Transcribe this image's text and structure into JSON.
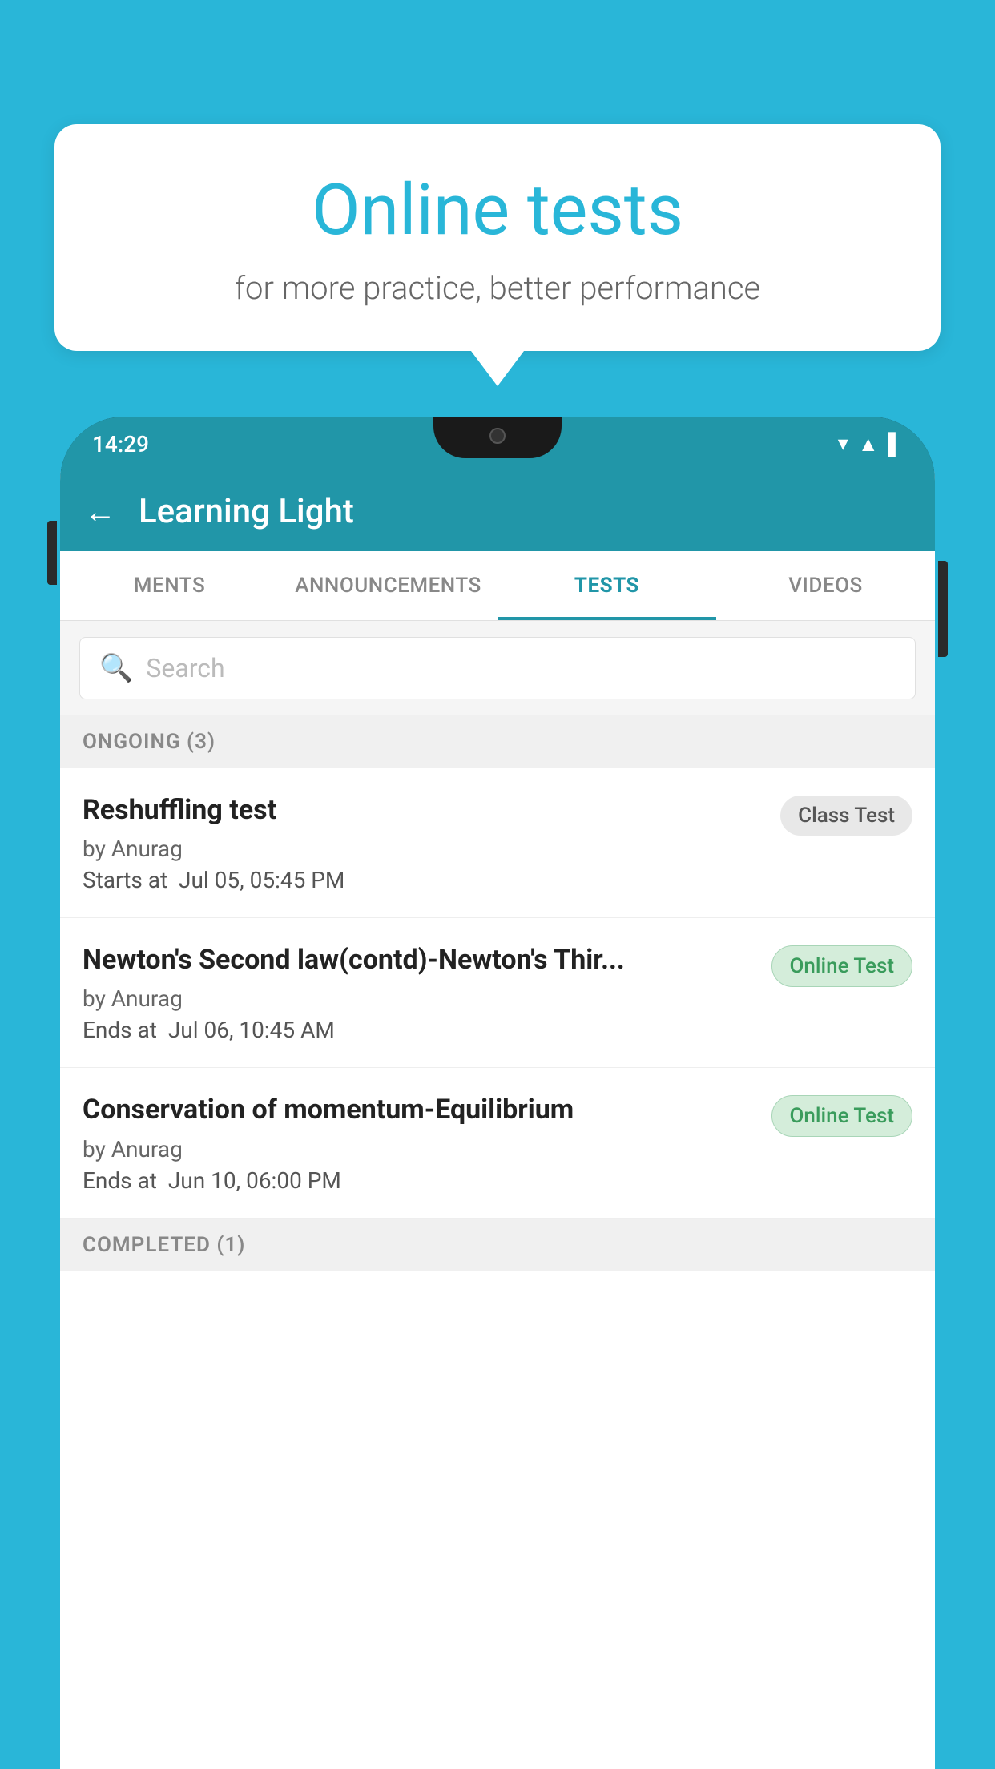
{
  "background_color": "#29b6d8",
  "bubble": {
    "title": "Online tests",
    "subtitle": "for more practice, better performance"
  },
  "phone": {
    "status_bar": {
      "time": "14:29",
      "icons": [
        "wifi",
        "signal",
        "battery"
      ]
    },
    "app_header": {
      "title": "Learning Light",
      "back_label": "←"
    },
    "tabs": [
      {
        "label": "MENTS",
        "active": false
      },
      {
        "label": "ANNOUNCEMENTS",
        "active": false
      },
      {
        "label": "TESTS",
        "active": true
      },
      {
        "label": "VIDEOS",
        "active": false
      }
    ],
    "search": {
      "placeholder": "Search"
    },
    "ongoing_section": {
      "header": "ONGOING (3)",
      "tests": [
        {
          "name": "Reshuffling test",
          "by": "by Anurag",
          "date_label": "Starts at",
          "date": "Jul 05, 05:45 PM",
          "badge": "Class Test",
          "badge_type": "class"
        },
        {
          "name": "Newton's Second law(contd)-Newton's Thir...",
          "by": "by Anurag",
          "date_label": "Ends at",
          "date": "Jul 06, 10:45 AM",
          "badge": "Online Test",
          "badge_type": "online"
        },
        {
          "name": "Conservation of momentum-Equilibrium",
          "by": "by Anurag",
          "date_label": "Ends at",
          "date": "Jun 10, 06:00 PM",
          "badge": "Online Test",
          "badge_type": "online"
        }
      ]
    },
    "completed_section": {
      "header": "COMPLETED (1)"
    }
  }
}
